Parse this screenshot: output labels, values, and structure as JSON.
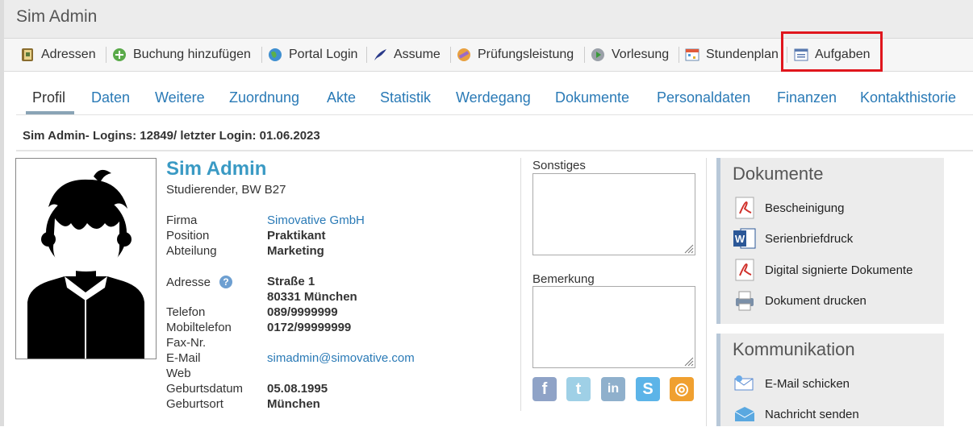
{
  "window": {
    "title": "Sim Admin"
  },
  "toolbar": {
    "items": [
      {
        "label": "Adressen",
        "icon": "address-book-icon"
      },
      {
        "label": "Buchung hinzufügen",
        "icon": "add-circle-icon"
      },
      {
        "label": "Portal Login",
        "icon": "globe-icon"
      },
      {
        "label": "Assume",
        "icon": "quill-icon"
      },
      {
        "label": "Prüfungsleistung",
        "icon": "grades-icon"
      },
      {
        "label": "Vorlesung",
        "icon": "lecture-icon"
      },
      {
        "label": "Stundenplan",
        "icon": "timetable-icon"
      },
      {
        "label": "Aufgaben",
        "icon": "tasks-icon"
      }
    ]
  },
  "tabs": [
    {
      "label": "Profil",
      "active": true
    },
    {
      "label": "Daten"
    },
    {
      "label": "Weitere"
    },
    {
      "label": "Zuordnung"
    },
    {
      "label": "Akte"
    },
    {
      "label": "Statistik"
    },
    {
      "label": "Werdegang"
    },
    {
      "label": "Dokumente"
    },
    {
      "label": "Personaldaten"
    },
    {
      "label": "Finanzen"
    },
    {
      "label": "Kontakthistorie"
    }
  ],
  "login_line": "Sim Admin- Logins: 12849/ letzter Login: 01.06.2023",
  "profile": {
    "name": "Sim Admin",
    "subtitle": "Studierender, BW B27",
    "fields": {
      "firma_label": "Firma",
      "firma": "Simovative GmbH",
      "position_label": "Position",
      "position": "Praktikant",
      "abteilung_label": "Abteilung",
      "abteilung": "Marketing",
      "adresse_label": "Adresse",
      "strasse": "Straße 1",
      "ort": "80331 München",
      "telefon_label": "Telefon",
      "telefon": "089/9999999",
      "mobil_label": "Mobiltelefon",
      "mobil": "0172/99999999",
      "fax_label": "Fax-Nr.",
      "email_label": "E-Mail",
      "email": "simadmin@simovative.com",
      "web_label": "Web",
      "geburtsdatum_label": "Geburtsdatum",
      "geburtsdatum": "05.08.1995",
      "geburtsort_label": "Geburtsort",
      "geburtsort": "München"
    }
  },
  "notes": {
    "sonstiges_label": "Sonstiges",
    "bemerkung_label": "Bemerkung"
  },
  "social": [
    {
      "name": "facebook-icon",
      "glyph": "f",
      "color": "#8fa3c7"
    },
    {
      "name": "twitter-icon",
      "glyph": "t",
      "color": "#9fd0e6"
    },
    {
      "name": "linkedin-icon",
      "glyph": "in",
      "color": "#8fb0cc"
    },
    {
      "name": "skype-icon",
      "glyph": "S",
      "color": "#5cb4e8"
    },
    {
      "name": "xing-icon",
      "glyph": "◎",
      "color": "#f0a030"
    }
  ],
  "dokumente": {
    "title": "Dokumente",
    "items": [
      {
        "label": "Bescheinigung",
        "icon": "pdf-icon"
      },
      {
        "label": "Serienbriefdruck",
        "icon": "word-icon"
      },
      {
        "label": "Digital signierte Dokumente",
        "icon": "pdf-icon"
      },
      {
        "label": "Dokument drucken",
        "icon": "printer-icon"
      }
    ]
  },
  "kommunikation": {
    "title": "Kommunikation",
    "items": [
      {
        "label": "E-Mail schicken",
        "icon": "email-icon"
      },
      {
        "label": "Nachricht senden",
        "icon": "message-icon"
      }
    ]
  },
  "colors": {
    "link": "#2a7ab6",
    "name": "#3a9ac4",
    "highlight": "#e0161d"
  }
}
